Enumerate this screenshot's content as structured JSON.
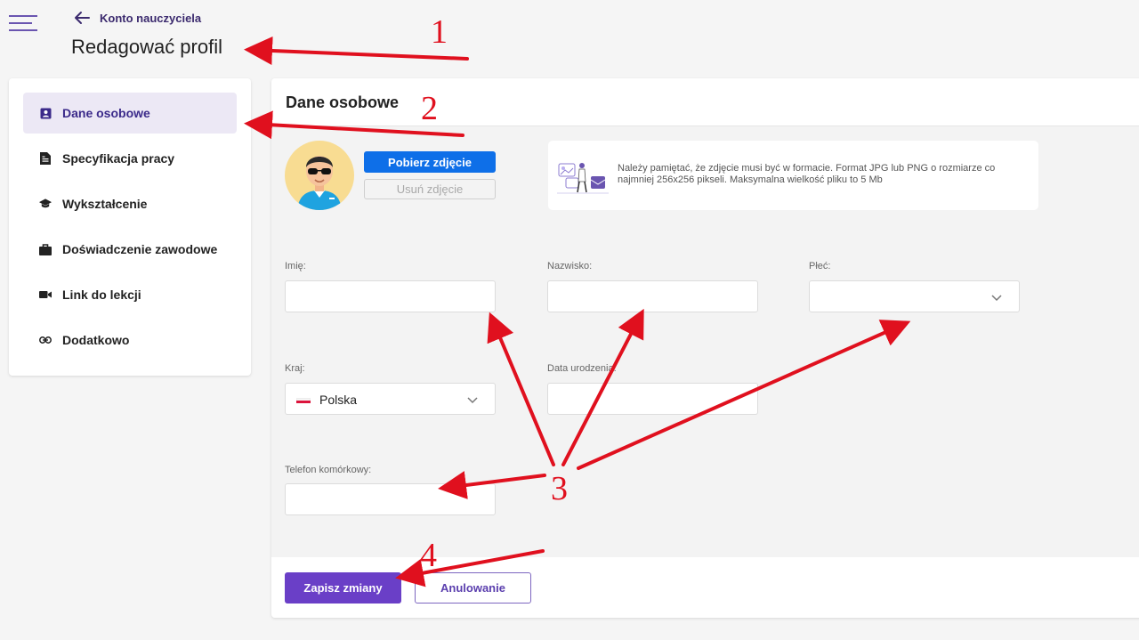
{
  "header": {
    "back_label": "Konto nauczyciela",
    "page_title": "Redagować profil"
  },
  "sidebar": {
    "items": [
      {
        "label": "Dane osobowe",
        "icon": "id-card-icon",
        "active": true
      },
      {
        "label": "Specyfikacja pracy",
        "icon": "document-icon",
        "active": false
      },
      {
        "label": "Wykształcenie",
        "icon": "graduation-cap-icon",
        "active": false
      },
      {
        "label": "Doświadczenie zawodowe",
        "icon": "briefcase-icon",
        "active": false
      },
      {
        "label": "Link do lekcji",
        "icon": "video-camera-icon",
        "active": false
      },
      {
        "label": "Dodatkowo",
        "icon": "link-icon",
        "active": false
      }
    ]
  },
  "main": {
    "title": "Dane osobowe",
    "photo": {
      "upload_label": "Pobierz zdjęcie",
      "remove_label": "Usuń zdjęcie"
    },
    "info_text": "Należy pamiętać, że zdjęcie musi być w formacie. Format JPG lub PNG o rozmiarze co najmniej 256x256 pikseli. Maksymalna wielkość pliku to 5 Mb",
    "fields": {
      "first_name": {
        "label": "Imię:",
        "value": ""
      },
      "last_name": {
        "label": "Nazwisko:",
        "value": ""
      },
      "gender": {
        "label": "Płeć:",
        "value": ""
      },
      "country": {
        "label": "Kraj:",
        "value": "Polska",
        "flag": "poland-flag-icon"
      },
      "birth_date": {
        "label": "Data urodzenia:",
        "value": ""
      },
      "phone": {
        "label": "Telefon komórkowy:",
        "value": ""
      }
    },
    "footer": {
      "save_label": "Zapisz zmiany",
      "cancel_label": "Anulowanie"
    }
  },
  "annotations": {
    "steps": [
      "1",
      "2",
      "3",
      "4"
    ],
    "color": "#e0101e"
  },
  "colors": {
    "accent_purple": "#6a3fc7",
    "upload_blue": "#0e6fe8",
    "active_bg": "#ece8f5"
  }
}
